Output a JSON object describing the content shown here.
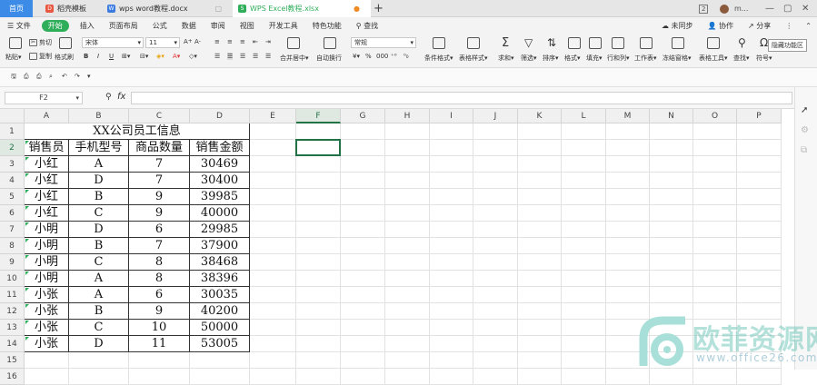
{
  "titlebar": {
    "tabs": [
      {
        "label": "首页"
      },
      {
        "label": "稻壳模板"
      },
      {
        "label": "wps word教程.docx"
      },
      {
        "label": "WPS Excel教程.xlsx"
      }
    ],
    "window_count": "2",
    "user": "m..."
  },
  "menubar": {
    "file": "文件",
    "items": [
      "开始",
      "插入",
      "页面布局",
      "公式",
      "数据",
      "审阅",
      "视图",
      "开发工具",
      "特色功能"
    ],
    "search": "查找",
    "right": [
      "未同步",
      "协作",
      "分享"
    ]
  },
  "ribbon": {
    "paste": "粘贴",
    "cut": "剪切",
    "copy": "复制",
    "format_painter": "格式刷",
    "font_name": "宋体",
    "font_size": "11",
    "merge_center": "合并居中",
    "wrap_text": "自动换行",
    "number_format": "常规",
    "conditional_format": "条件格式",
    "table_style": "表格样式",
    "sum": "求和",
    "filter": "筛选",
    "sort": "排序",
    "format": "格式",
    "fill": "填充",
    "row_col": "行和列",
    "worksheet": "工作表",
    "freeze": "冻结窗格",
    "table_tools": "表格工具",
    "find": "查找",
    "symbol": "符号",
    "hide_ribbon": "隐藏功能区"
  },
  "formula_bar": {
    "name_box": "F2",
    "fx": "fx",
    "content": ""
  },
  "sheet": {
    "columns": [
      "A",
      "B",
      "C",
      "D",
      "E",
      "F",
      "G",
      "H",
      "I",
      "J",
      "K",
      "L",
      "M",
      "N",
      "O",
      "P"
    ],
    "rows": [
      "1",
      "2",
      "3",
      "4",
      "5",
      "6",
      "7",
      "8",
      "9",
      "10",
      "11",
      "12",
      "13",
      "14",
      "15",
      "16"
    ],
    "title": "XX公司员工信息",
    "headers": [
      "销售员",
      "手机型号",
      "商品数量",
      "销售金额"
    ],
    "data": [
      [
        "小红",
        "A",
        "7",
        "30469"
      ],
      [
        "小红",
        "D",
        "7",
        "30400"
      ],
      [
        "小红",
        "B",
        "9",
        "39985"
      ],
      [
        "小红",
        "C",
        "9",
        "40000"
      ],
      [
        "小明",
        "D",
        "6",
        "29985"
      ],
      [
        "小明",
        "B",
        "7",
        "37900"
      ],
      [
        "小明",
        "C",
        "8",
        "38468"
      ],
      [
        "小明",
        "A",
        "8",
        "38396"
      ],
      [
        "小张",
        "A",
        "6",
        "30035"
      ],
      [
        "小张",
        "B",
        "9",
        "40200"
      ],
      [
        "小张",
        "C",
        "10",
        "50000"
      ],
      [
        "小张",
        "D",
        "11",
        "53005"
      ]
    ],
    "selected_cell": "F2"
  },
  "watermark": {
    "name": "欧菲资源网",
    "url": "www.office26.com"
  },
  "colors": {
    "accent_green": "#2fae5a",
    "selection": "#217346",
    "tab_blue": "#3c8ce7"
  }
}
